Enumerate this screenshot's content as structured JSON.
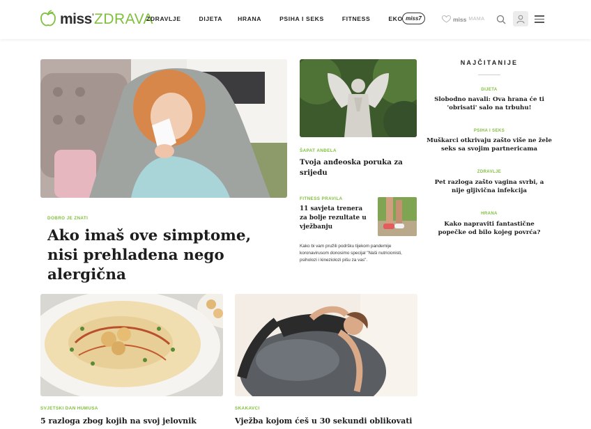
{
  "brand": {
    "miss": "miss",
    "apostrophe": "’",
    "zdrava": "ZDRAVA"
  },
  "nav": {
    "items": [
      "ZDRAVLJE",
      "DIJETA",
      "HRANA",
      "PSIHA I SEKS",
      "FITNESS",
      "EKO"
    ],
    "badge": "miss7",
    "missmama_miss": "miss",
    "missmama_mama": "MAMA",
    "icons": [
      "search-icon",
      "user-icon",
      "menu-icon"
    ]
  },
  "colors": {
    "accent": "#7fbf3c",
    "title": "#1d1d1d",
    "user_bg": "#ececec"
  },
  "hero": {
    "category": "DOBRO JE ZNATI",
    "title": "Ako imaš ove simptome, nisi prehladena nego alergična"
  },
  "angel": {
    "category": "ŠAPAT ANĐELA",
    "title": "Tvoja anđeoska poruka za srijedu"
  },
  "fitness": {
    "category": "FITNESS PRAVILA",
    "title": "11 savjeta trenera za bolje rezultate u vježbanju",
    "body": "Kako bi vam pružili podršku tijekom pandemije koronavirusom donosimo specijal \"Naši nutricionisti, psiholozi i kineziolozi pišu za vas\"."
  },
  "hummus": {
    "category": "SVJETSKI DAN HUMUSA",
    "title": "5 razloga zbog kojih na svoj jelovnik"
  },
  "exercise": {
    "category": "SKAKAVCI",
    "title": "Vježba kojom ćeš u 30 sekundi oblikovati"
  },
  "sidebar": {
    "heading": "NAJČITANIJE",
    "items": [
      {
        "category": "DIJETA",
        "title": "Slobodno navali: Ova hrana će ti 'obrisati' salo na trbuhu!"
      },
      {
        "category": "PSIHA I SEKS",
        "title": "Muškarci otkrivaju zašto više ne žele seks sa svojim partnericama"
      },
      {
        "category": "ZDRAVLJE",
        "title": "Pet razloga zašto vagina svrbi, a nije gljivična infekcija"
      },
      {
        "category": "HRANA",
        "title": "Kako napraviti fantastične popečke od bilo kojeg povrća?"
      }
    ]
  }
}
